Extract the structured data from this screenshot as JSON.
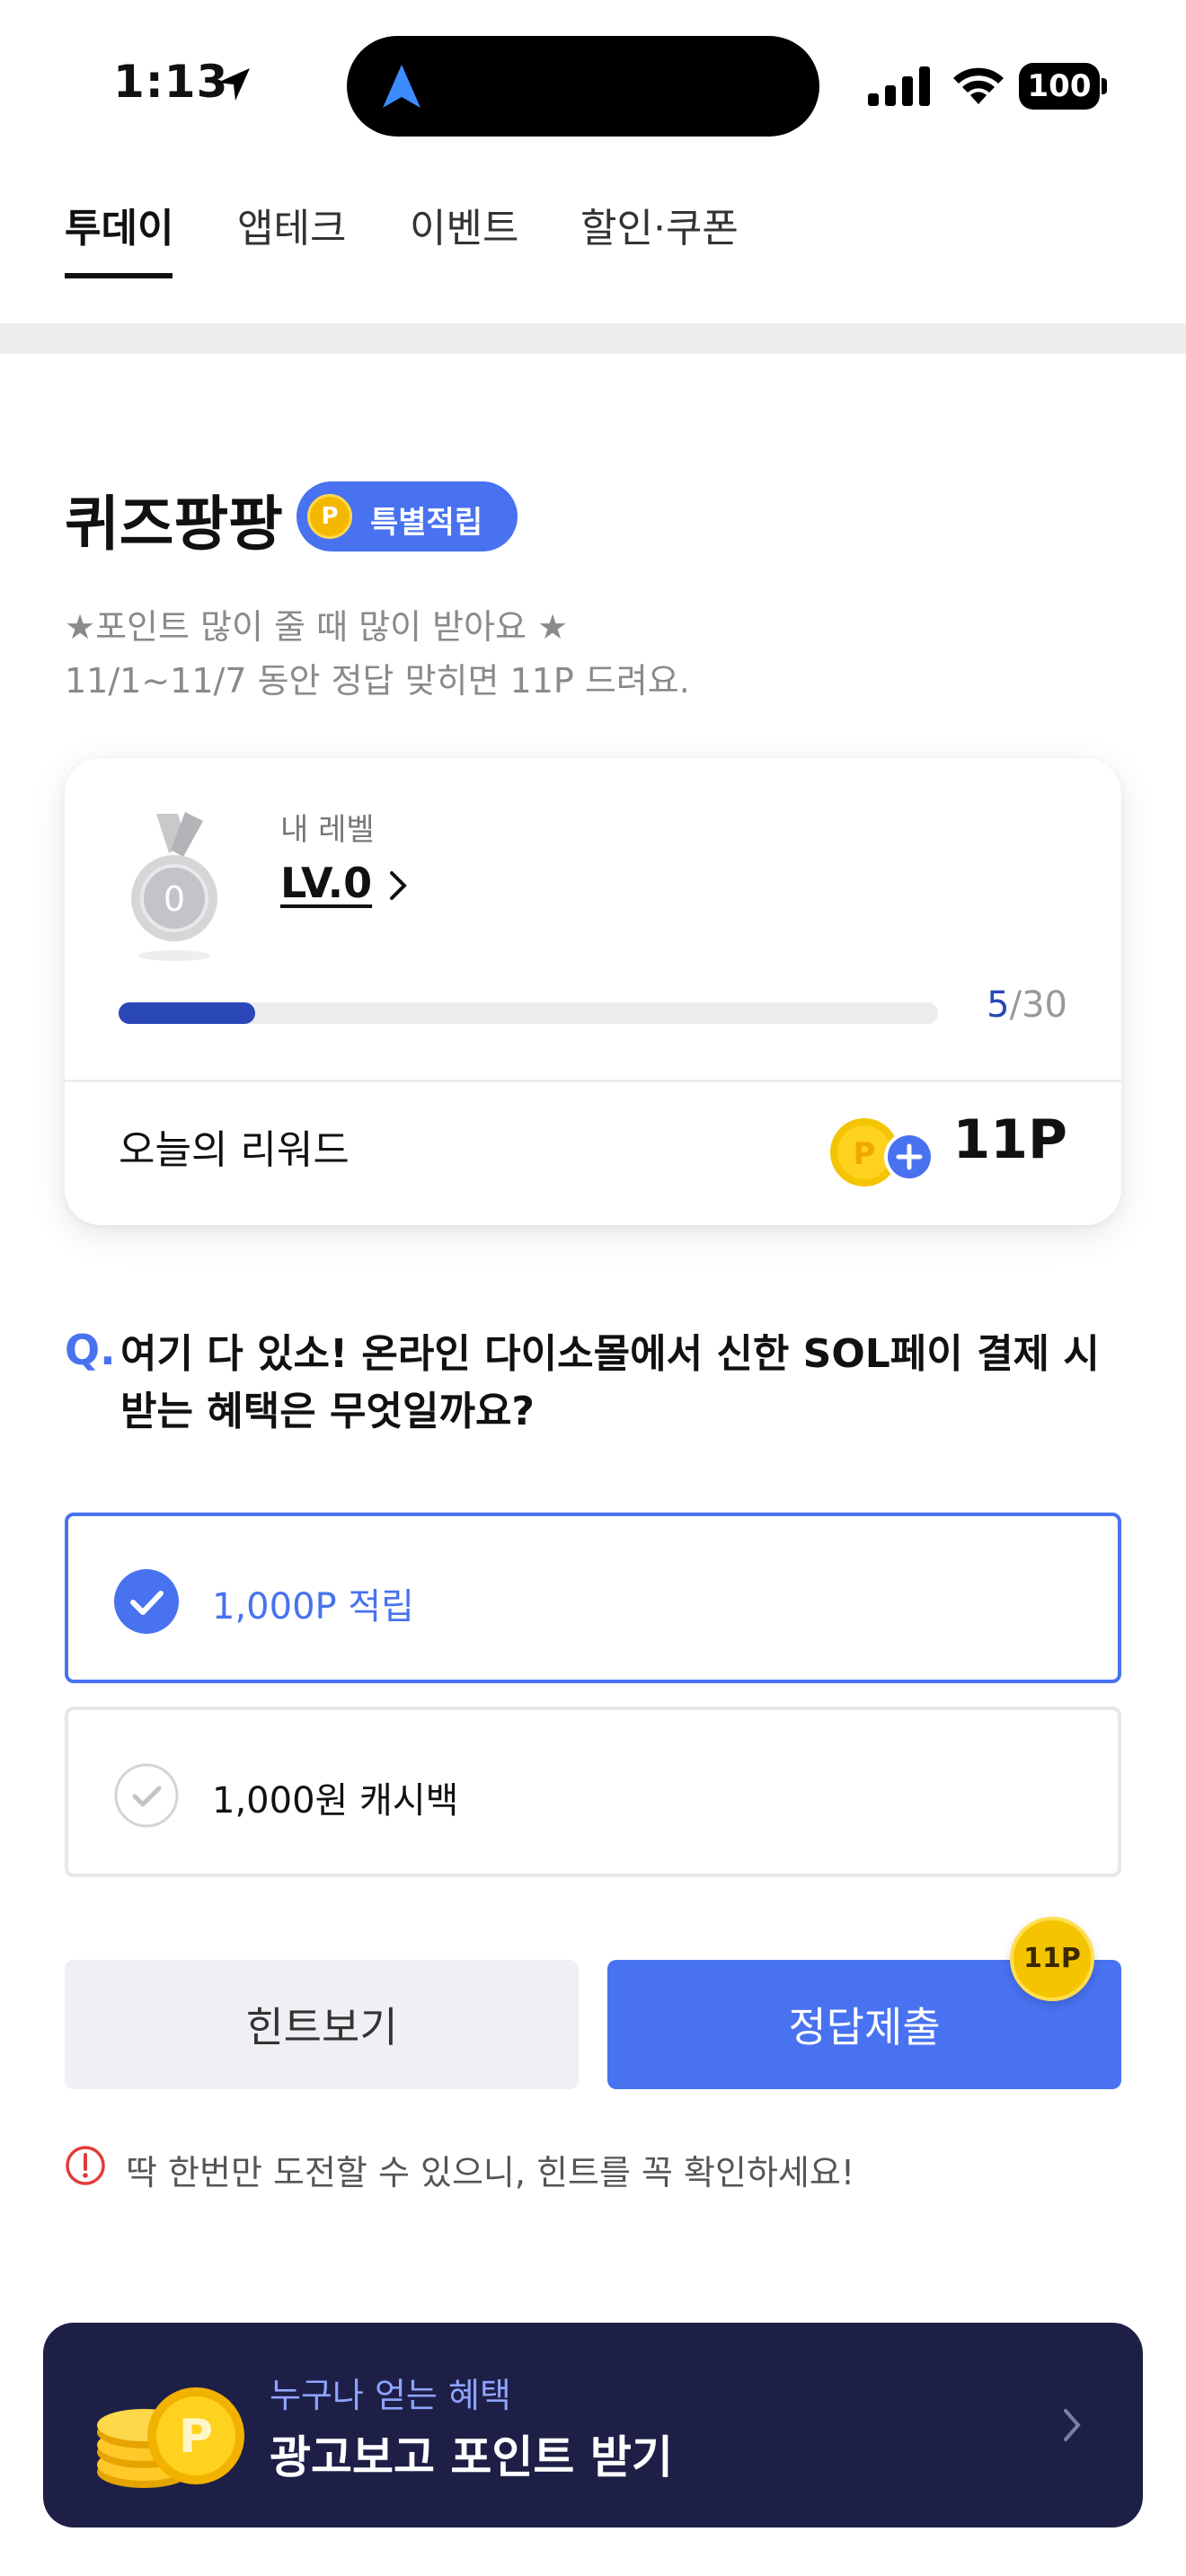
{
  "status_bar": {
    "time": "1:13",
    "battery": "100"
  },
  "tabs": [
    {
      "label": "투데이",
      "active": true
    },
    {
      "label": "앱테크",
      "active": false
    },
    {
      "label": "이벤트",
      "active": false
    },
    {
      "label": "할인·쿠폰",
      "active": false
    }
  ],
  "quiz": {
    "title": "퀴즈팡팡",
    "badge_coin": "P",
    "badge_label": "특별적립",
    "desc_line1": "★포인트 많이 줄 때 많이 받아요 ★",
    "desc_line2": "11/1~11/7 동안 정답 맞히면 11P 드려요."
  },
  "level_card": {
    "medal_number": "0",
    "level_label": "내 레벨",
    "level_value": "LV.0",
    "progress_current": "5",
    "progress_total": "/30",
    "progress_fraction": 0.167,
    "reward_label": "오늘의 리워드",
    "reward_coin": "P",
    "reward_value": "11P"
  },
  "question": {
    "mark": "Q.",
    "text": "여기 다 있소! 온라인 다이소몰에서 신한 SOL페이 결제 시 받는 혜택은 무엇일까요?"
  },
  "options": [
    {
      "label": "1,000P 적립",
      "selected": true
    },
    {
      "label": "1,000원 캐시백",
      "selected": false
    }
  ],
  "buttons": {
    "hint": "힌트보기",
    "submit": "정답제출",
    "submit_badge": "11P"
  },
  "warning": "딱 한번만 도전할 수 있으니, 힌트를 꼭 확인하세요!",
  "ad_banner": {
    "subtitle": "누구나 얻는 혜택",
    "title": "광고보고 포인트 받기",
    "coin_letter": "P"
  },
  "colors": {
    "accent": "#4872f0",
    "progress": "#2a47b8",
    "coin": "#f5c400",
    "banner": "#1d1f47"
  }
}
